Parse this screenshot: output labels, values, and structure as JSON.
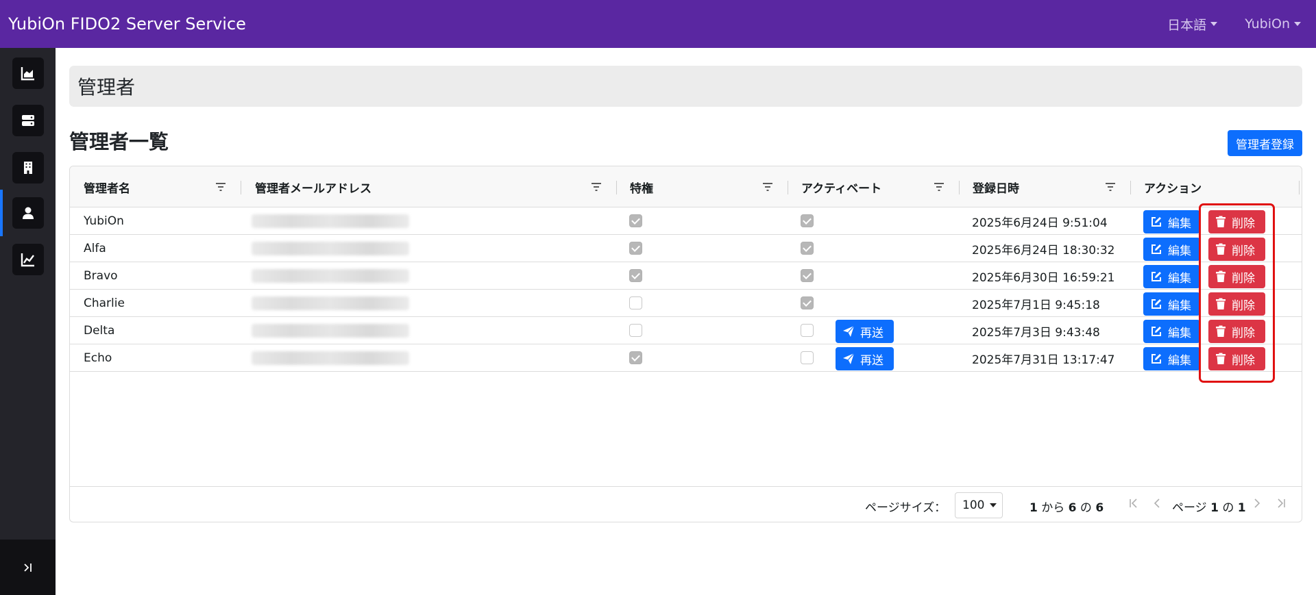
{
  "app": {
    "title": "YubiOn FIDO2 Server Service"
  },
  "navbar": {
    "language": "日本語",
    "user": "YubiOn"
  },
  "sidebar": {
    "items": [
      {
        "icon": "area-chart-icon"
      },
      {
        "icon": "server-icon"
      },
      {
        "icon": "building-icon"
      },
      {
        "icon": "user-icon",
        "active": true
      },
      {
        "icon": "line-chart-icon"
      }
    ],
    "expand_icon": "expand-sidebar-icon"
  },
  "page": {
    "header": "管理者",
    "section_title": "管理者一覧",
    "register_button": "管理者登録"
  },
  "table": {
    "columns": [
      "管理者名",
      "管理者メールアドレス",
      "特権",
      "アクティベート",
      "登録日時",
      "アクション"
    ],
    "rows": [
      {
        "name": "YubiOn",
        "privilege": true,
        "activated": true,
        "registered": "2025年6月24日 9:51:04"
      },
      {
        "name": "Alfa",
        "privilege": true,
        "activated": true,
        "registered": "2025年6月24日 18:30:32"
      },
      {
        "name": "Bravo",
        "privilege": true,
        "activated": true,
        "registered": "2025年6月30日 16:59:21"
      },
      {
        "name": "Charlie",
        "privilege": false,
        "activated": true,
        "registered": "2025年7月1日 9:45:18"
      },
      {
        "name": "Delta",
        "privilege": false,
        "activated": false,
        "resend": true,
        "registered": "2025年7月3日 9:43:48"
      },
      {
        "name": "Echo",
        "privilege": true,
        "activated": false,
        "resend": true,
        "registered": "2025年7月31日 13:17:47"
      }
    ],
    "edit_label": "編集",
    "delete_label": "削除",
    "resend_label": "再送"
  },
  "pagination": {
    "page_size_label": "ページサイズ：",
    "page_size": "100",
    "summary_from": "1",
    "summary_from_suffix": "から",
    "summary_to": "6",
    "summary_of": "の",
    "summary_total": "6",
    "page_prefix": "ページ",
    "page_current": "1",
    "page_of": "の",
    "page_total": "1"
  },
  "colors": {
    "navbar": "#5a27a1",
    "primary": "#0d6efd",
    "danger": "#dc3545",
    "highlight": "#e01010"
  }
}
